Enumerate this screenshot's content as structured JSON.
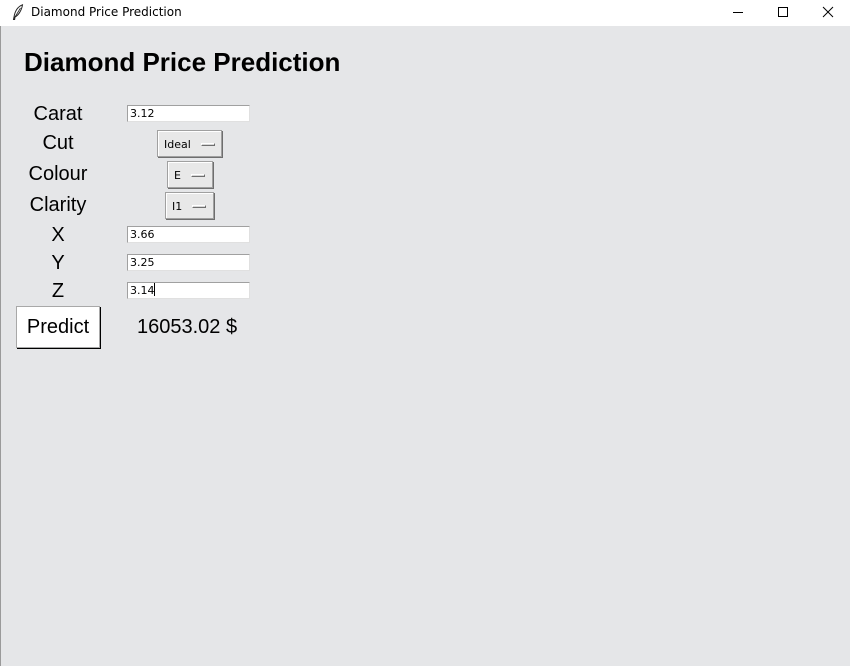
{
  "window": {
    "title": "Diamond Price Prediction",
    "controls": {
      "minimize_icon": "minimize-icon",
      "maximize_icon": "maximize-icon",
      "close_icon": "close-icon"
    }
  },
  "form": {
    "heading": "Diamond Price Prediction",
    "carat": {
      "label": "Carat",
      "value": "3.12"
    },
    "cut": {
      "label": "Cut",
      "selected": "Ideal"
    },
    "colour": {
      "label": "Colour",
      "selected": "E"
    },
    "clarity": {
      "label": "Clarity",
      "selected": "I1"
    },
    "x": {
      "label": "X",
      "value": "3.66"
    },
    "y": {
      "label": "Y",
      "value": "3.25"
    },
    "z": {
      "label": "Z",
      "value": "3.14"
    },
    "predict_label": "Predict",
    "result": "16053.02 $"
  },
  "colors": {
    "background": "#e5e6e8",
    "titlebar": "#ffffff"
  }
}
